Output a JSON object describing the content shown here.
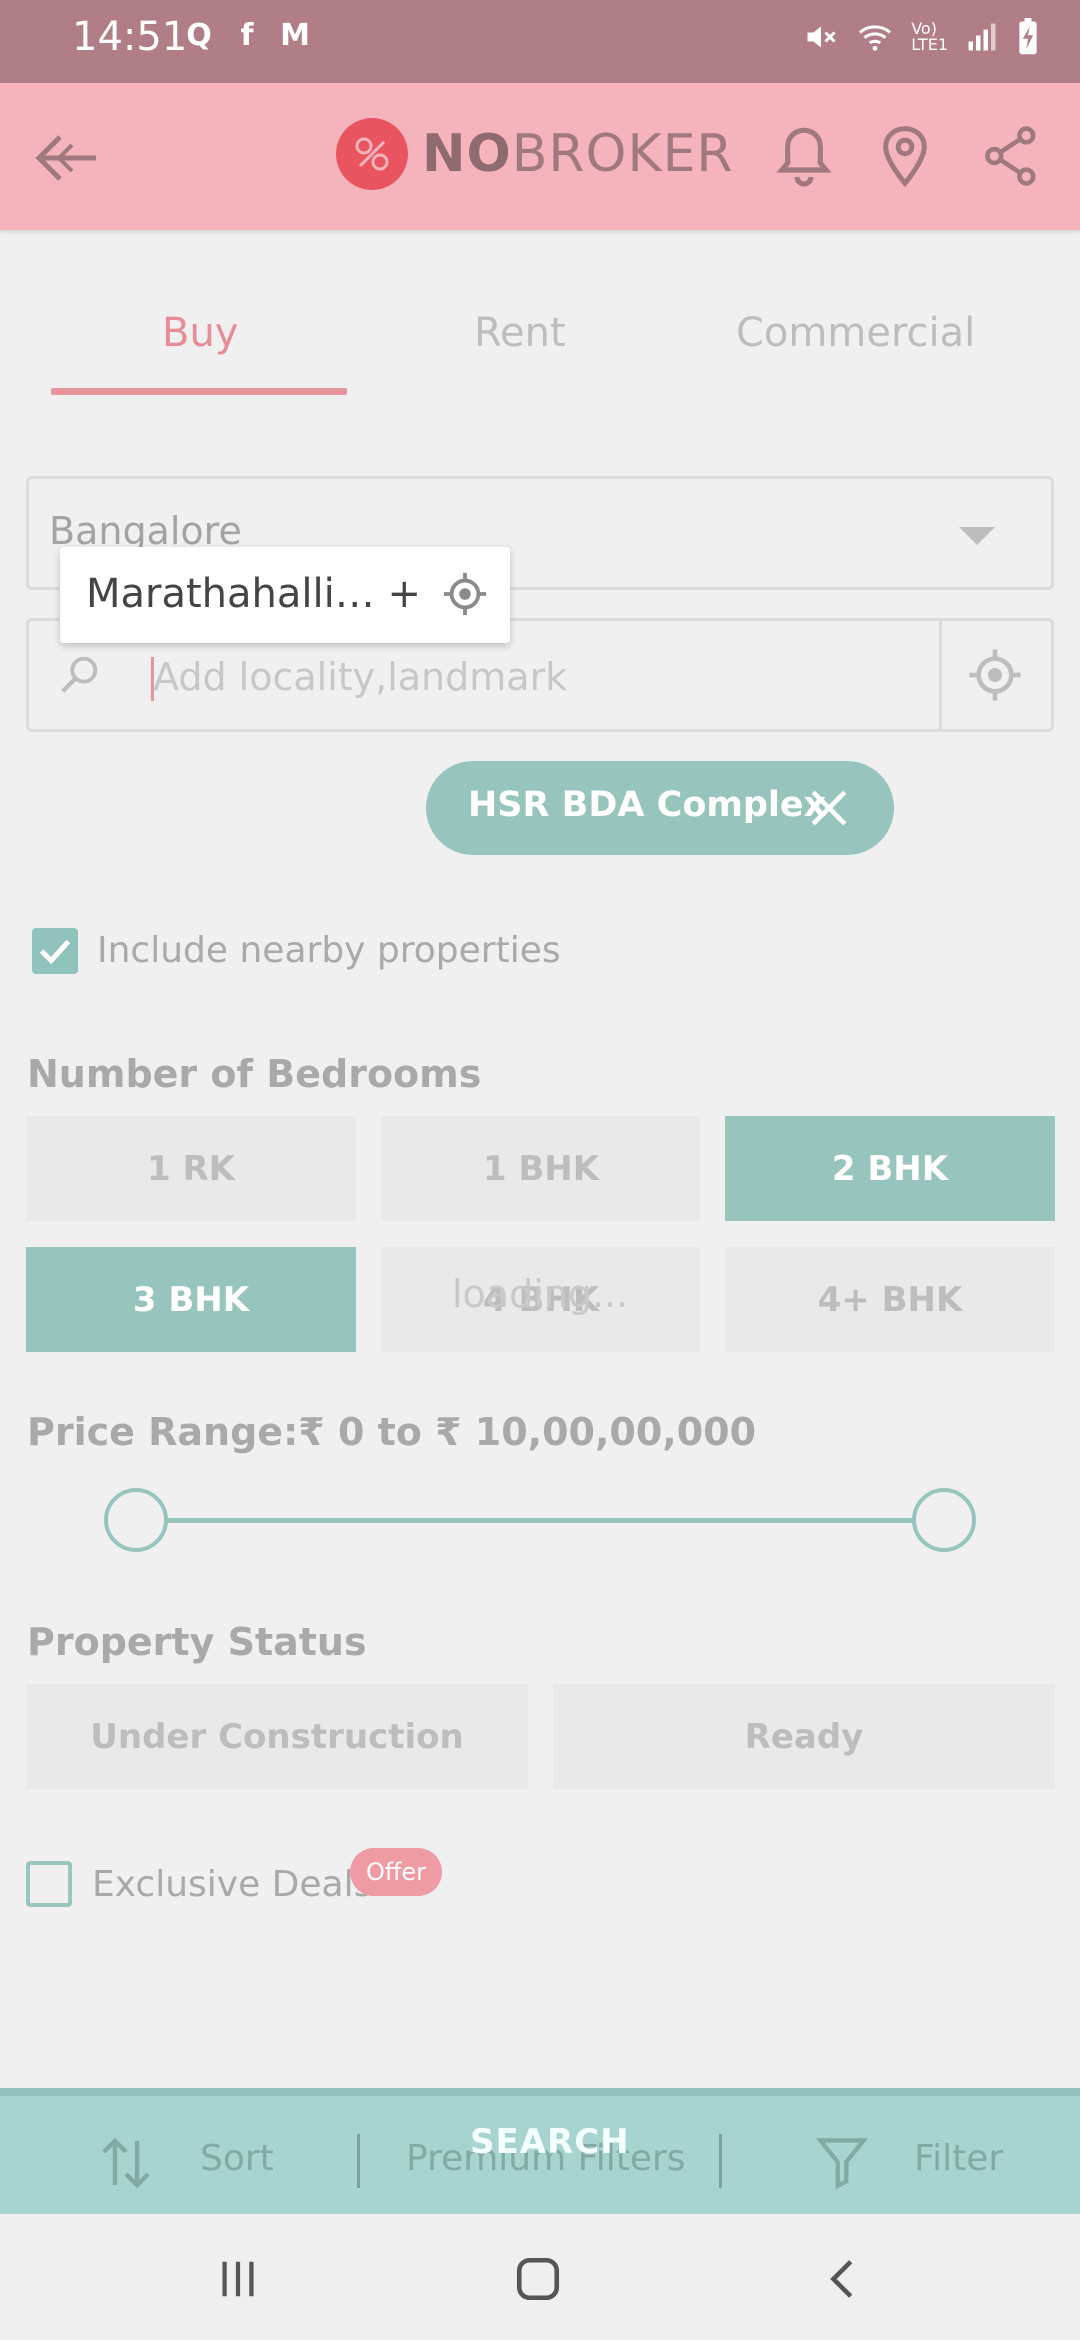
{
  "status_bar": {
    "time": "14:51",
    "notif_icons": [
      "Q",
      "f",
      "M"
    ]
  },
  "header": {
    "logo_no": "NO",
    "logo_broker": "BROKER"
  },
  "tabs": [
    {
      "label": "Buy",
      "active": true
    },
    {
      "label": "Rent",
      "active": false
    },
    {
      "label": "Commercial",
      "active": false
    }
  ],
  "city": {
    "value": "Bangalore"
  },
  "search": {
    "placeholder": "Add locality,landmark"
  },
  "suggestion_popup": {
    "text": "Marathahalli…  +"
  },
  "locality_chip": {
    "label": "HSR BDA Complex"
  },
  "nearby": {
    "label": "Include nearby properties",
    "checked": true
  },
  "bedrooms": {
    "title": "Number of Bedrooms",
    "options": [
      {
        "label": "1 RK",
        "selected": false
      },
      {
        "label": "1 BHK",
        "selected": false
      },
      {
        "label": "2 BHK",
        "selected": true
      },
      {
        "label": "3 BHK",
        "selected": true
      },
      {
        "label": "4 BHK",
        "selected": false
      },
      {
        "label": "4+ BHK",
        "selected": false
      }
    ],
    "loading_text": "loading..."
  },
  "price": {
    "label": "Price Range:₹ 0   to   ₹ 10,00,00,000",
    "min": 0,
    "max": 100000000
  },
  "property_status": {
    "title": "Property Status",
    "options": [
      "Under Construction",
      "Ready"
    ]
  },
  "exclusive": {
    "label": "Exclusive Deals",
    "badge": "Offer",
    "checked": false
  },
  "bottom_bar": {
    "sort": "Sort",
    "premium": "Premium Filters",
    "search": "SEARCH",
    "filter": "Filter"
  },
  "colors": {
    "status_bar": "#b17d87",
    "header": "#f5b3bb",
    "brand_red": "#e8545f",
    "teal": "#97c5be",
    "tab_active": "#e88d97"
  }
}
